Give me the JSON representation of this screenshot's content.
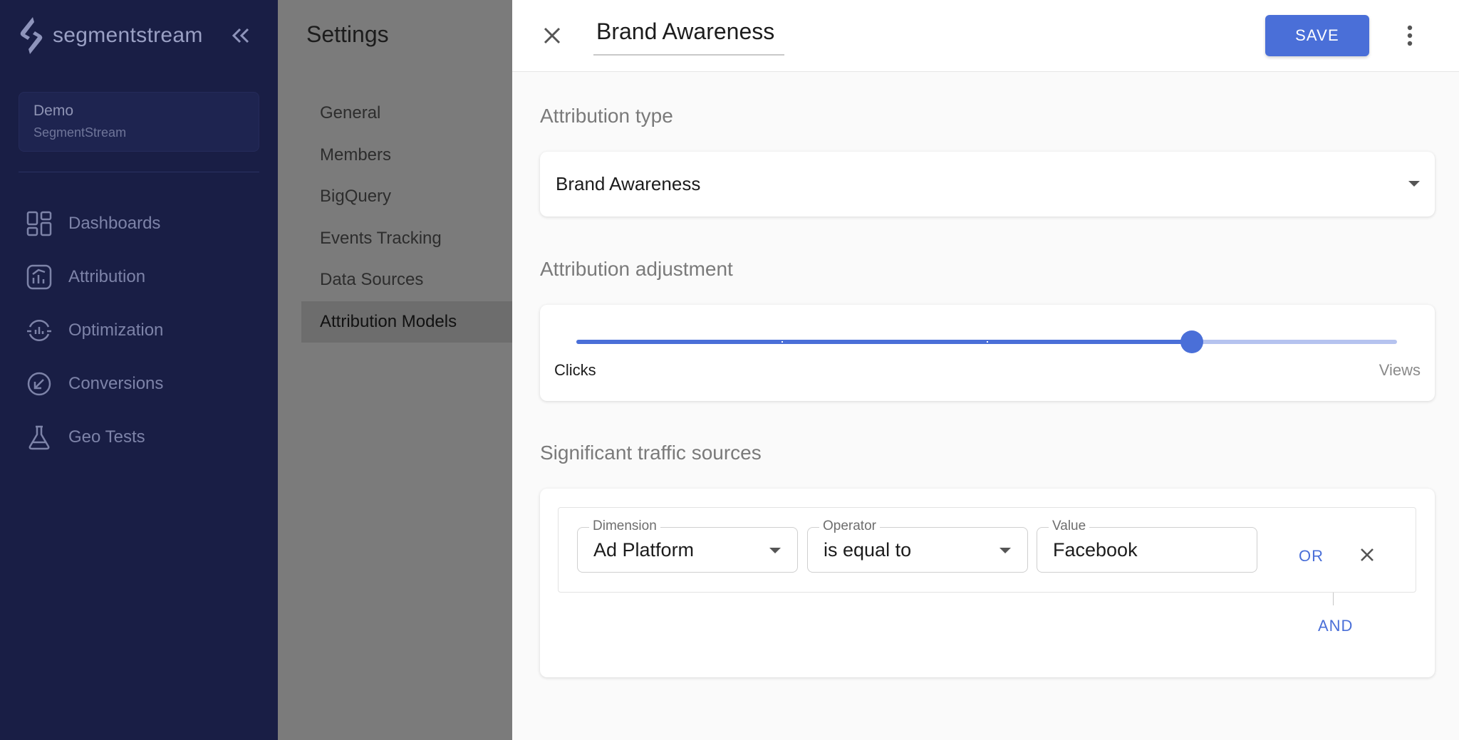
{
  "sidebar": {
    "logo_text": "segmentstream",
    "workspace": {
      "name": "Demo",
      "org": "SegmentStream"
    },
    "items": [
      {
        "label": "Dashboards",
        "icon": "dashboard-icon"
      },
      {
        "label": "Attribution",
        "icon": "attribution-icon"
      },
      {
        "label": "Optimization",
        "icon": "optimization-icon"
      },
      {
        "label": "Conversions",
        "icon": "conversions-icon"
      },
      {
        "label": "Geo Tests",
        "icon": "flask-icon"
      }
    ]
  },
  "settings": {
    "title": "Settings",
    "nav": [
      {
        "label": "General"
      },
      {
        "label": "Members"
      },
      {
        "label": "BigQuery"
      },
      {
        "label": "Events Tracking"
      },
      {
        "label": "Data Sources"
      },
      {
        "label": "Attribution Models",
        "active": true
      }
    ]
  },
  "drawer": {
    "title": "Brand Awareness",
    "save_label": "SAVE",
    "attribution_type": {
      "label": "Attribution type",
      "value": "Brand Awareness"
    },
    "attribution_adjustment": {
      "label": "Attribution adjustment",
      "min_label": "Clicks",
      "max_label": "Views",
      "value_fraction": 0.75,
      "steps": 4
    },
    "traffic_sources": {
      "label": "Significant traffic sources",
      "condition": {
        "dimension_label": "Dimension",
        "dimension_value": "Ad Platform",
        "operator_label": "Operator",
        "operator_value": "is equal to",
        "value_label": "Value",
        "value_value": "Facebook"
      },
      "or_label": "OR",
      "and_label": "AND"
    }
  },
  "colors": {
    "sidebar_bg": "#191e45",
    "accent": "#4a6fd8",
    "overlay": "#7b7b7b"
  }
}
